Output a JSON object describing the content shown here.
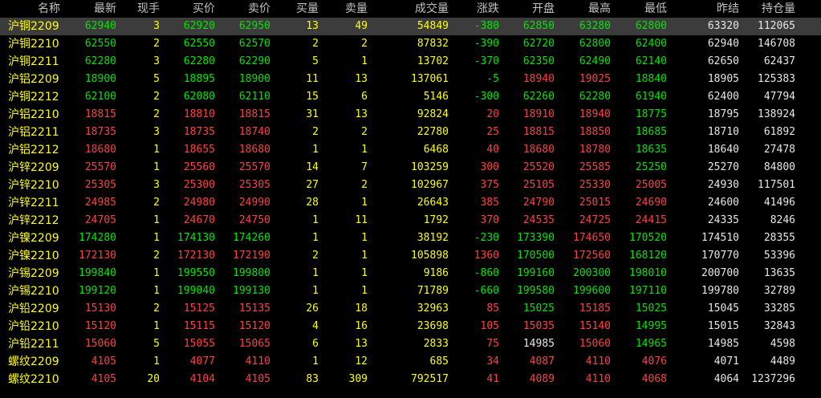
{
  "columns": [
    {
      "key": "name",
      "label": "名称"
    },
    {
      "key": "last",
      "label": "最新"
    },
    {
      "key": "vol_now",
      "label": "现手"
    },
    {
      "key": "bid",
      "label": "买价"
    },
    {
      "key": "ask",
      "label": "卖价"
    },
    {
      "key": "bid_vol",
      "label": "买量"
    },
    {
      "key": "ask_vol",
      "label": "卖量"
    },
    {
      "key": "volume",
      "label": "成交量"
    },
    {
      "key": "change",
      "label": "涨跌"
    },
    {
      "key": "open",
      "label": "开盘"
    },
    {
      "key": "high",
      "label": "最高"
    },
    {
      "key": "low",
      "label": "最低"
    },
    {
      "key": "prev_settle",
      "label": "昨结"
    },
    {
      "key": "open_interest",
      "label": "持仓量"
    }
  ],
  "colors": {
    "up": "#ff4040",
    "down": "#00e600",
    "neutral": "#e6e6e6",
    "name": "#ffff00",
    "quantity": "#ffff00",
    "selected_row_bg": "#3c3c3c"
  },
  "selected_row_index": 0,
  "rows": [
    {
      "name": "沪铜2209",
      "last": "62940",
      "vol_now": "3",
      "bid": "62920",
      "ask": "62950",
      "bid_vol": "13",
      "ask_vol": "49",
      "volume": "54849",
      "change": "-380",
      "open": "62850",
      "high": "63280",
      "low": "62800",
      "prev_settle": "63320",
      "open_interest": "112065"
    },
    {
      "name": "沪铜2210",
      "last": "62550",
      "vol_now": "2",
      "bid": "62550",
      "ask": "62570",
      "bid_vol": "2",
      "ask_vol": "2",
      "volume": "87832",
      "change": "-390",
      "open": "62720",
      "high": "62800",
      "low": "62400",
      "prev_settle": "62940",
      "open_interest": "146708"
    },
    {
      "name": "沪铜2211",
      "last": "62280",
      "vol_now": "3",
      "bid": "62280",
      "ask": "62290",
      "bid_vol": "5",
      "ask_vol": "1",
      "volume": "13702",
      "change": "-370",
      "open": "62350",
      "high": "62490",
      "low": "62140",
      "prev_settle": "62650",
      "open_interest": "62437"
    },
    {
      "name": "沪铝2209",
      "last": "18900",
      "vol_now": "5",
      "bid": "18895",
      "ask": "18900",
      "bid_vol": "11",
      "ask_vol": "13",
      "volume": "137061",
      "change": "-5",
      "open": "18940",
      "high": "19025",
      "low": "18840",
      "prev_settle": "18905",
      "open_interest": "125383"
    },
    {
      "name": "沪铜2212",
      "last": "62100",
      "vol_now": "2",
      "bid": "62080",
      "ask": "62110",
      "bid_vol": "15",
      "ask_vol": "6",
      "volume": "5146",
      "change": "-300",
      "open": "62260",
      "high": "62280",
      "low": "61940",
      "prev_settle": "62400",
      "open_interest": "47794"
    },
    {
      "name": "沪铝2210",
      "last": "18815",
      "vol_now": "2",
      "bid": "18810",
      "ask": "18815",
      "bid_vol": "31",
      "ask_vol": "13",
      "volume": "92824",
      "change": "20",
      "open": "18910",
      "high": "18940",
      "low": "18775",
      "prev_settle": "18795",
      "open_interest": "138924"
    },
    {
      "name": "沪铝2211",
      "last": "18735",
      "vol_now": "3",
      "bid": "18735",
      "ask": "18740",
      "bid_vol": "2",
      "ask_vol": "2",
      "volume": "22780",
      "change": "25",
      "open": "18815",
      "high": "18850",
      "low": "18685",
      "prev_settle": "18710",
      "open_interest": "61892"
    },
    {
      "name": "沪铝2212",
      "last": "18680",
      "vol_now": "1",
      "bid": "18655",
      "ask": "18680",
      "bid_vol": "1",
      "ask_vol": "1",
      "volume": "6468",
      "change": "40",
      "open": "18680",
      "high": "18780",
      "low": "18635",
      "prev_settle": "18640",
      "open_interest": "27478"
    },
    {
      "name": "沪锌2209",
      "last": "25570",
      "vol_now": "1",
      "bid": "25560",
      "ask": "25570",
      "bid_vol": "14",
      "ask_vol": "7",
      "volume": "103259",
      "change": "300",
      "open": "25520",
      "high": "25585",
      "low": "25250",
      "prev_settle": "25270",
      "open_interest": "84800"
    },
    {
      "name": "沪锌2210",
      "last": "25305",
      "vol_now": "3",
      "bid": "25300",
      "ask": "25305",
      "bid_vol": "27",
      "ask_vol": "2",
      "volume": "102967",
      "change": "375",
      "open": "25105",
      "high": "25330",
      "low": "25005",
      "prev_settle": "24930",
      "open_interest": "117501"
    },
    {
      "name": "沪锌2211",
      "last": "24985",
      "vol_now": "2",
      "bid": "24980",
      "ask": "24990",
      "bid_vol": "28",
      "ask_vol": "1",
      "volume": "26643",
      "change": "385",
      "open": "24790",
      "high": "25015",
      "low": "24690",
      "prev_settle": "24600",
      "open_interest": "41496"
    },
    {
      "name": "沪锌2212",
      "last": "24705",
      "vol_now": "1",
      "bid": "24670",
      "ask": "24750",
      "bid_vol": "1",
      "ask_vol": "11",
      "volume": "1792",
      "change": "370",
      "open": "24535",
      "high": "24725",
      "low": "24415",
      "prev_settle": "24335",
      "open_interest": "8246"
    },
    {
      "name": "沪镍2209",
      "last": "174280",
      "vol_now": "1",
      "bid": "174130",
      "ask": "174260",
      "bid_vol": "1",
      "ask_vol": "1",
      "volume": "38192",
      "change": "-230",
      "open": "173390",
      "high": "174650",
      "low": "170520",
      "prev_settle": "174510",
      "open_interest": "28355"
    },
    {
      "name": "沪镍2210",
      "last": "172130",
      "vol_now": "2",
      "bid": "172130",
      "ask": "172190",
      "bid_vol": "2",
      "ask_vol": "1",
      "volume": "105898",
      "change": "1360",
      "open": "170500",
      "high": "172560",
      "low": "168120",
      "prev_settle": "170770",
      "open_interest": "53396"
    },
    {
      "name": "沪锡2209",
      "last": "199840",
      "vol_now": "1",
      "bid": "199550",
      "ask": "199800",
      "bid_vol": "1",
      "ask_vol": "1",
      "volume": "9186",
      "change": "-860",
      "open": "199160",
      "high": "200300",
      "low": "198010",
      "prev_settle": "200700",
      "open_interest": "13635"
    },
    {
      "name": "沪锡2210",
      "last": "199120",
      "vol_now": "1",
      "bid": "199040",
      "ask": "199130",
      "bid_vol": "1",
      "ask_vol": "1",
      "volume": "71789",
      "change": "-660",
      "open": "199580",
      "high": "199600",
      "low": "197110",
      "prev_settle": "199780",
      "open_interest": "32789"
    },
    {
      "name": "沪铅2209",
      "last": "15130",
      "vol_now": "2",
      "bid": "15125",
      "ask": "15135",
      "bid_vol": "26",
      "ask_vol": "18",
      "volume": "32963",
      "change": "85",
      "open": "15025",
      "high": "15185",
      "low": "15025",
      "prev_settle": "15045",
      "open_interest": "33285"
    },
    {
      "name": "沪铅2210",
      "last": "15120",
      "vol_now": "1",
      "bid": "15115",
      "ask": "15120",
      "bid_vol": "4",
      "ask_vol": "16",
      "volume": "23698",
      "change": "105",
      "open": "15035",
      "high": "15140",
      "low": "14995",
      "prev_settle": "15015",
      "open_interest": "32843"
    },
    {
      "name": "沪铅2211",
      "last": "15060",
      "vol_now": "5",
      "bid": "15055",
      "ask": "15065",
      "bid_vol": "6",
      "ask_vol": "13",
      "volume": "2833",
      "change": "75",
      "open": "14985",
      "high": "15060",
      "low": "14965",
      "prev_settle": "14985",
      "open_interest": "4598"
    },
    {
      "name": "螺纹2209",
      "last": "4105",
      "vol_now": "1",
      "bid": "4077",
      "ask": "4110",
      "bid_vol": "1",
      "ask_vol": "12",
      "volume": "685",
      "change": "34",
      "open": "4087",
      "high": "4110",
      "low": "4076",
      "prev_settle": "4071",
      "open_interest": "4489"
    },
    {
      "name": "螺纹2210",
      "last": "4105",
      "vol_now": "20",
      "bid": "4104",
      "ask": "4105",
      "bid_vol": "83",
      "ask_vol": "309",
      "volume": "792517",
      "change": "41",
      "open": "4089",
      "high": "4110",
      "low": "4068",
      "prev_settle": "4064",
      "open_interest": "1237296"
    }
  ]
}
